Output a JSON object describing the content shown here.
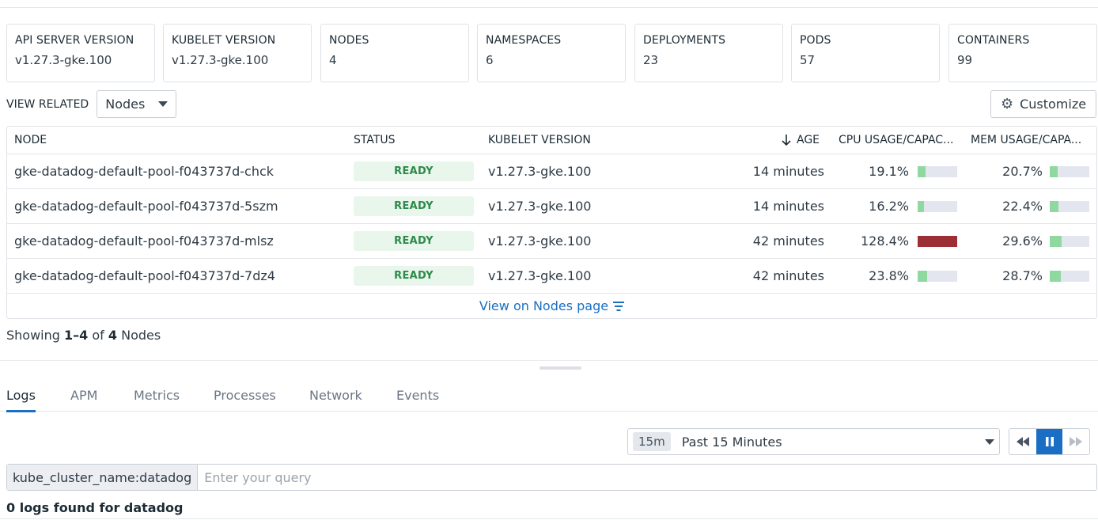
{
  "summary_cards": [
    {
      "label": "API SERVER VERSION",
      "value": "v1.27.3-gke.100"
    },
    {
      "label": "KUBELET VERSION",
      "value": "v1.27.3-gke.100"
    },
    {
      "label": "NODES",
      "value": "4"
    },
    {
      "label": "NAMESPACES",
      "value": "6"
    },
    {
      "label": "DEPLOYMENTS",
      "value": "23"
    },
    {
      "label": "PODS",
      "value": "57"
    },
    {
      "label": "CONTAINERS",
      "value": "99"
    }
  ],
  "related": {
    "label": "VIEW RELATED",
    "selected": "Nodes",
    "customize_label": "Customize"
  },
  "table": {
    "columns": {
      "node": "NODE",
      "status": "STATUS",
      "kubelet": "KUBELET VERSION",
      "age": "AGE",
      "cpu": "CPU USAGE/CAPAC...",
      "mem": "MEM USAGE/CAPA..."
    },
    "rows": [
      {
        "node": "gke-datadog-default-pool-f043737d-chck",
        "status": "READY",
        "kubelet": "v1.27.3-gke.100",
        "age": "14 minutes",
        "cpu": "19.1%",
        "cpu_fraction": 0.191,
        "mem": "20.7%",
        "mem_fraction": 0.207
      },
      {
        "node": "gke-datadog-default-pool-f043737d-5szm",
        "status": "READY",
        "kubelet": "v1.27.3-gke.100",
        "age": "14 minutes",
        "cpu": "16.2%",
        "cpu_fraction": 0.162,
        "mem": "22.4%",
        "mem_fraction": 0.224
      },
      {
        "node": "gke-datadog-default-pool-f043737d-mlsz",
        "status": "READY",
        "kubelet": "v1.27.3-gke.100",
        "age": "42 minutes",
        "cpu": "128.4%",
        "cpu_fraction": 1.284,
        "mem": "29.6%",
        "mem_fraction": 0.296
      },
      {
        "node": "gke-datadog-default-pool-f043737d-7dz4",
        "status": "READY",
        "kubelet": "v1.27.3-gke.100",
        "age": "42 minutes",
        "cpu": "23.8%",
        "cpu_fraction": 0.238,
        "mem": "28.7%",
        "mem_fraction": 0.287
      }
    ],
    "footer_link": "View on Nodes page"
  },
  "showing": {
    "prefix": "Showing",
    "range": "1–4",
    "of": "of",
    "total": "4",
    "noun": "Nodes"
  },
  "tabs": [
    "Logs",
    "APM",
    "Metrics",
    "Processes",
    "Network",
    "Events"
  ],
  "active_tab": "Logs",
  "timepicker": {
    "badge": "15m",
    "label": "Past 15 Minutes"
  },
  "query": {
    "tag": "kube_cluster_name:datadog",
    "placeholder": "Enter your query"
  },
  "result_text": "0 logs found for datadog",
  "colors": {
    "accent": "#1a6fc4",
    "usage_ok": "#8fd9a0",
    "usage_over": "#9b2f35",
    "ready_bg": "#e8f6ec",
    "ready_text": "#2e8a4a"
  }
}
